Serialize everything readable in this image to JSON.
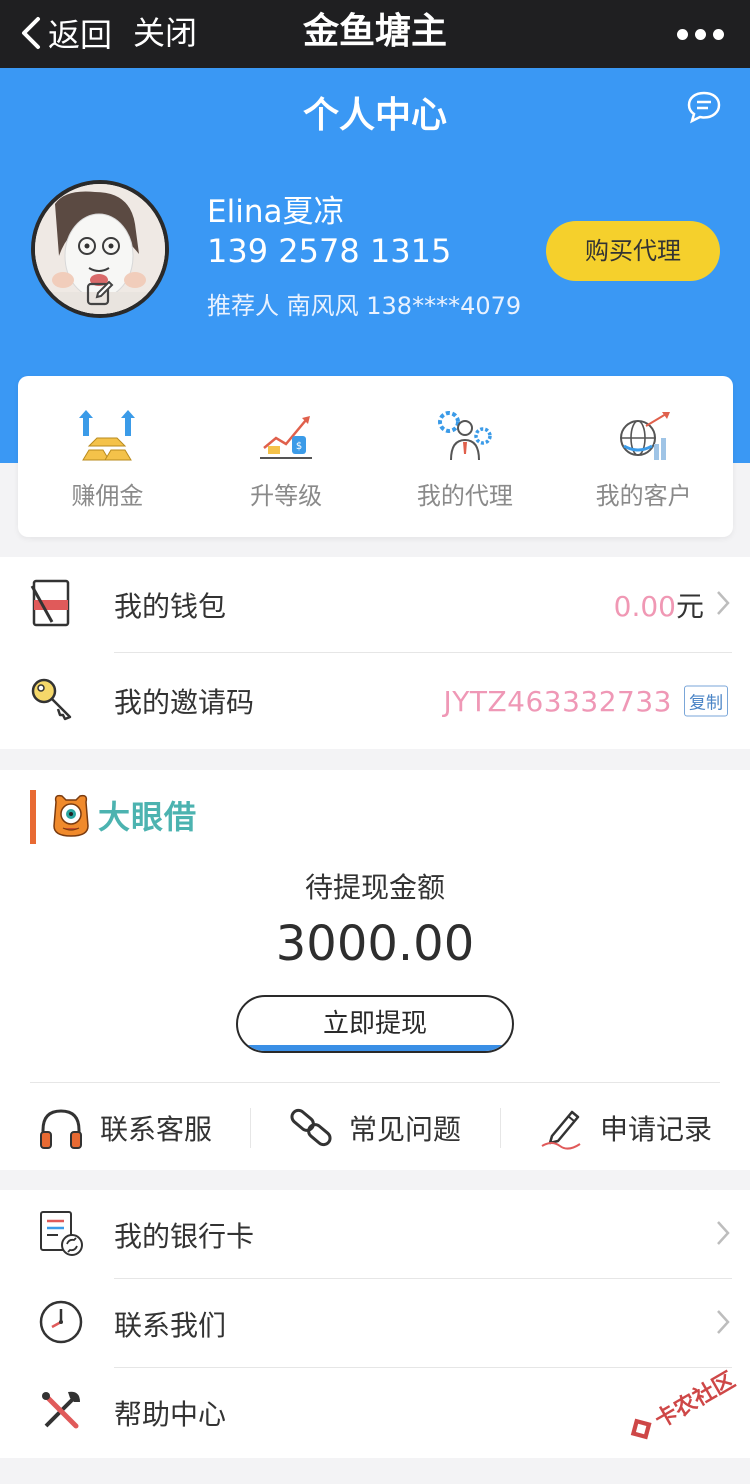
{
  "nav": {
    "back_label": "返回",
    "close_label": "关闭",
    "title": "金鱼塘主"
  },
  "header": {
    "title": "个人中心",
    "user_name": "Elina夏凉",
    "phone": "139 2578 1315",
    "referrer": "推荐人 南风风 138****4079",
    "buy_agent_label": "购买代理"
  },
  "features": [
    {
      "label": "赚佣金",
      "icon": "gold-bars-icon"
    },
    {
      "label": "升等级",
      "icon": "growth-chart-icon"
    },
    {
      "label": "我的代理",
      "icon": "agent-gear-icon"
    },
    {
      "label": "我的客户",
      "icon": "globe-chart-icon"
    }
  ],
  "account": {
    "wallet_label": "我的钱包",
    "wallet_amount": "0.00",
    "wallet_unit": "元",
    "invite_label": "我的邀请码",
    "invite_code": "JYTZ463332733",
    "copy_label": "复制"
  },
  "loan": {
    "brand_name": "大眼借",
    "pending_label": "待提现金额",
    "pending_amount": "3000.00",
    "withdraw_label": "立即提现",
    "actions": [
      {
        "label": "联系客服",
        "icon": "headphones-icon"
      },
      {
        "label": "常见问题",
        "icon": "link-icon"
      },
      {
        "label": "申请记录",
        "icon": "pen-icon"
      }
    ]
  },
  "menu": [
    {
      "label": "我的银行卡",
      "icon": "bank-card-icon"
    },
    {
      "label": "联系我们",
      "icon": "clock-icon"
    },
    {
      "label": "帮助中心",
      "icon": "tools-icon"
    }
  ],
  "watermark": "卡农社区",
  "colors": {
    "header_blue": "#3a98f4",
    "buy_yellow": "#f5d02c",
    "pink_value": "#ef98b6",
    "accent_orange": "#e86a33",
    "brand_teal": "#4cb3b0"
  }
}
